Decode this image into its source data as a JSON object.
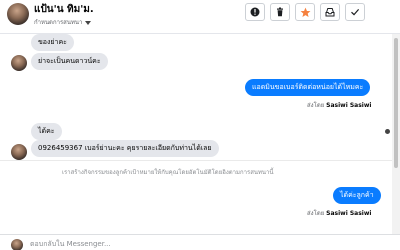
{
  "header": {
    "name": "แป้น'น ทิม'ม.",
    "assign_label": "กำหนดการสนทนา",
    "buttons": [
      "info-icon",
      "trash-icon",
      "star-icon",
      "inbox-icon",
      "check-icon"
    ],
    "accent_star": "#f5813f"
  },
  "messages": [
    {
      "type": "in",
      "text": "ของย่าคะ"
    },
    {
      "type": "in",
      "text": "ย่าจะเป็นคนดาวน์คะ"
    },
    {
      "type": "out",
      "text": "แอดมินขอเบอร์ติดต่อหน่อยได้ไหมคะ",
      "sent_by_label": "ส่งโดย",
      "sender": "Sasiwi Sasiwi"
    },
    {
      "type": "in",
      "text": "ได้คะ"
    },
    {
      "type": "in",
      "text": "0926459367 เบอร์ย่านะคะ คุยรายละเอียดกับท่านได้เลย"
    },
    {
      "type": "out",
      "text": "ได้ค่ะลูกค้า",
      "sent_by_label": "ส่งโดย",
      "sender": "Sasiwi Sasiwi"
    }
  ],
  "notice": "เราสร้างกิจกรรมของลูกค้าเป้าหมายให้กับคุณโดยอัตโนมัติโดยอิงตามการสนทนานี้",
  "composer": {
    "placeholder": "ตอบกลับใน Messenger..."
  },
  "colors": {
    "bubble_out": "#0a7cff",
    "bubble_in": "#e4e6eb"
  }
}
